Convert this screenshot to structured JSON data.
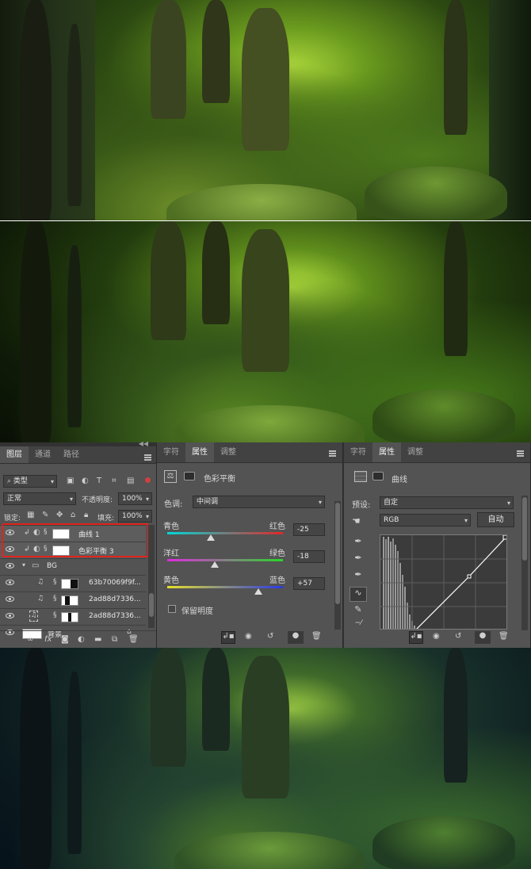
{
  "layers_panel": {
    "tabs": [
      "图层",
      "通道",
      "路径"
    ],
    "filter": "类型",
    "blend_mode": "正常",
    "opacity_label": "不透明度:",
    "opacity_value": "100%",
    "lock_label": "锁定:",
    "fill_label": "填充:",
    "fill_value": "100%",
    "layers": [
      {
        "name": "曲线 1"
      },
      {
        "name": "色彩平衡 3"
      },
      {
        "name": "BG"
      },
      {
        "name": "63b70069f9f..."
      },
      {
        "name": "2ad88d7336..."
      },
      {
        "name": "2ad88d7336..."
      },
      {
        "name": "背景"
      }
    ],
    "footer_fx": "fx"
  },
  "color_balance_panel": {
    "tabs": [
      "字符",
      "属性",
      "调整"
    ],
    "title": "色彩平衡",
    "tone_label": "色调:",
    "tone_value": "中间调",
    "sliders": [
      {
        "left": "青色",
        "right": "红色",
        "value": "-25",
        "level": -25
      },
      {
        "left": "洋红",
        "right": "绿色",
        "value": "-18",
        "level": -18
      },
      {
        "left": "黄色",
        "right": "蓝色",
        "value": "+57",
        "level": 57
      }
    ],
    "preserve_label": "保留明度"
  },
  "curves_panel": {
    "tabs": [
      "字符",
      "属性",
      "调整"
    ],
    "title": "曲线",
    "preset_label": "预设:",
    "preset_value": "自定",
    "channel_value": "RGB",
    "auto_button": "自动"
  },
  "colors": {
    "panel_bg": "#535353",
    "tab_bar": "#424242",
    "highlight_red": "#e0231b"
  },
  "icons": [
    "eye-icon",
    "link-icon",
    "folder-icon",
    "lock-icon",
    "fx-icon",
    "mask-icon",
    "adjustment-icon",
    "new-layer-icon",
    "trash-icon",
    "eyedropper-icon",
    "curve-tool-icon",
    "pencil-icon",
    "hand-icon",
    "reset-icon",
    "visibility-icon",
    "clip-icon"
  ]
}
